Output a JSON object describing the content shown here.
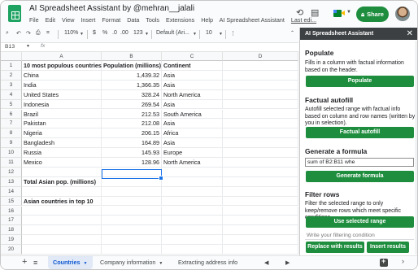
{
  "header": {
    "title": "AI Spreadsheet Assistant by @mehran__jalali",
    "menu": [
      "File",
      "Edit",
      "View",
      "Insert",
      "Format",
      "Data",
      "Tools",
      "Extensions",
      "Help",
      "AI Spreadsheet Assistant"
    ],
    "last_edit": "Last edi...",
    "share_label": "Share",
    "share_icon": "lock-icon"
  },
  "toolbar": {
    "zoom": "110%",
    "currency": "$",
    "percent": "%",
    "dec_decrease": ".0",
    "dec_increase": ".00",
    "more_formats": "123",
    "font": "Default (Ari...",
    "font_size": "10"
  },
  "formula_bar": {
    "name_box": "B13",
    "fx": "fx"
  },
  "columns": [
    "A",
    "B",
    "C",
    "D"
  ],
  "rows": [
    {
      "n": "1",
      "a": "10 most populous countries",
      "b": "Population (millions)",
      "c": "Continent"
    },
    {
      "n": "2",
      "a": "China",
      "b": "1,439.32",
      "c": "Asia"
    },
    {
      "n": "3",
      "a": "India",
      "b": "1,366.35",
      "c": "Asia"
    },
    {
      "n": "4",
      "a": "United States",
      "b": "328.24",
      "c": "North America"
    },
    {
      "n": "5",
      "a": "Indonesia",
      "b": "269.54",
      "c": "Asia"
    },
    {
      "n": "6",
      "a": "Brazil",
      "b": "212.53",
      "c": "South America"
    },
    {
      "n": "7",
      "a": "Pakistan",
      "b": "212.08",
      "c": "Asia"
    },
    {
      "n": "8",
      "a": "Nigeria",
      "b": "206.15",
      "c": "Africa"
    },
    {
      "n": "9",
      "a": "Bangladesh",
      "b": "164.89",
      "c": "Asia"
    },
    {
      "n": "10",
      "a": "Russia",
      "b": "145.93",
      "c": "Europe"
    },
    {
      "n": "11",
      "a": "Mexico",
      "b": "128.96",
      "c": "North America"
    },
    {
      "n": "12",
      "a": "",
      "b": "",
      "c": ""
    },
    {
      "n": "13",
      "a": "Total Asian pop. (millions)",
      "b": "",
      "c": ""
    },
    {
      "n": "14",
      "a": "",
      "b": "",
      "c": ""
    },
    {
      "n": "15",
      "a": "Asian countries in top 10",
      "b": "",
      "c": ""
    },
    {
      "n": "16",
      "a": "",
      "b": "",
      "c": ""
    },
    {
      "n": "17",
      "a": "",
      "b": "",
      "c": ""
    },
    {
      "n": "18",
      "a": "",
      "b": "",
      "c": ""
    },
    {
      "n": "19",
      "a": "",
      "b": "",
      "c": ""
    },
    {
      "n": "20",
      "a": "",
      "b": "",
      "c": ""
    }
  ],
  "sheets": {
    "tabs": [
      "Countries",
      "Company information",
      "Extracting address info"
    ],
    "active": "Countries"
  },
  "panel": {
    "title": "AI Spreadsheet Assistant",
    "close": "✕",
    "populate": {
      "heading": "Populate",
      "desc": "Fills in a column with factual information based on the header.",
      "button": "Populate"
    },
    "autofill": {
      "heading": "Factual autofill",
      "desc": "Autofill selected range with factual info based on column and row names (written by you in selection).",
      "button": "Factual autofill"
    },
    "formula": {
      "heading": "Generate a formula",
      "input_value": "sum of B2:B11 whe",
      "button": "Generate formula"
    },
    "filter": {
      "heading": "Filter rows",
      "desc": "Filter the selected range to only keep/remove rows which meet specific conditions.",
      "button": "Use selected range",
      "placeholder": "Write your filtering condition",
      "replace_button": "Replace with results",
      "insert_button": "Insert results"
    }
  },
  "colors": {
    "accent_green": "#1e8e3e",
    "selection_blue": "#1a73e8",
    "panel_header": "#3c4043"
  }
}
